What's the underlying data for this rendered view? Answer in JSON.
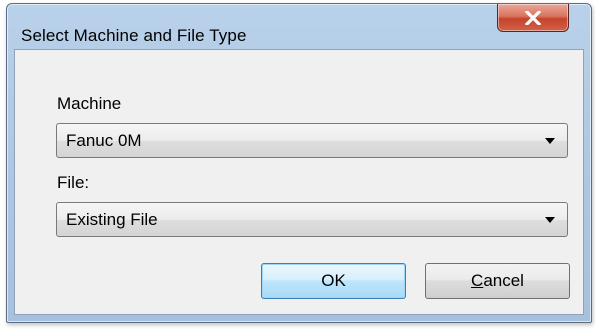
{
  "window": {
    "title": "Select Machine and File Type",
    "close_icon": "close-x-icon"
  },
  "machine": {
    "label": "Machine",
    "value": "Fanuc 0M"
  },
  "file": {
    "label": "File:",
    "value": "Existing File"
  },
  "buttons": {
    "ok_label": "OK",
    "cancel_mnemonic": "C",
    "cancel_rest": "ancel"
  },
  "colors": {
    "titlebar": "#b9d1ea",
    "close_button": "#c7432b",
    "client_bg": "#f0f0f0",
    "default_button_border": "#3c7fb1"
  }
}
